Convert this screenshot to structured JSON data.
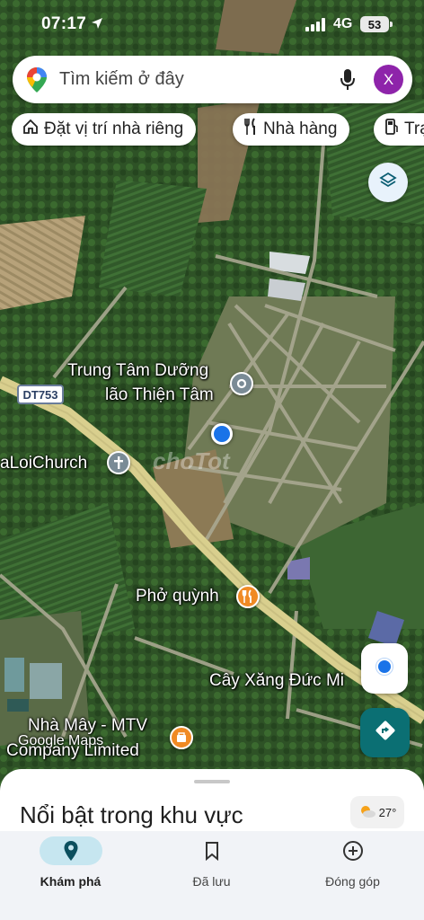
{
  "status_bar": {
    "time": "07:17",
    "network": "4G",
    "battery": "53"
  },
  "search": {
    "placeholder": "Tìm kiếm ở đây",
    "avatar_letter": "X"
  },
  "chips": [
    {
      "label": "Đặt vị trí nhà riêng",
      "icon": "home-icon"
    },
    {
      "label": "Nhà hàng",
      "icon": "restaurant-icon"
    },
    {
      "label": "Trạm xăng",
      "icon": "gas-station-icon"
    }
  ],
  "map": {
    "road_shield": "DT753",
    "places": [
      {
        "name": "Trung Tâm Dưỡng",
        "name2": "lão Thiện Tâm",
        "icon": "place-pin-icon"
      },
      {
        "name": "aLoiChurch",
        "icon": "church-icon"
      },
      {
        "name": "Phở quỳnh",
        "icon": "restaurant-icon"
      },
      {
        "name": "Cây Xăng Đức Mi",
        "icon": "gas-station-icon"
      },
      {
        "name": "Nhà Mây - MTV",
        "name2": "Company Limited",
        "icon": "shop-icon"
      }
    ],
    "watermark": "choTot",
    "attribution": "Google Maps"
  },
  "sheet": {
    "title": "Nổi bật trong khu vực",
    "temperature": "27°"
  },
  "bottom_nav": [
    {
      "label": "Khám phá",
      "icon": "explore-pin-icon",
      "active": true
    },
    {
      "label": "Đã lưu",
      "icon": "bookmark-icon",
      "active": false
    },
    {
      "label": "Đóng góp",
      "icon": "add-circle-icon",
      "active": false
    }
  ],
  "colors": {
    "accent_blue": "#1a73e8",
    "direction_button": "#0b6f73",
    "avatar": "#8e24aa",
    "nav_active_pill": "#c6e6f0",
    "main_road": "#d9cf8e"
  }
}
